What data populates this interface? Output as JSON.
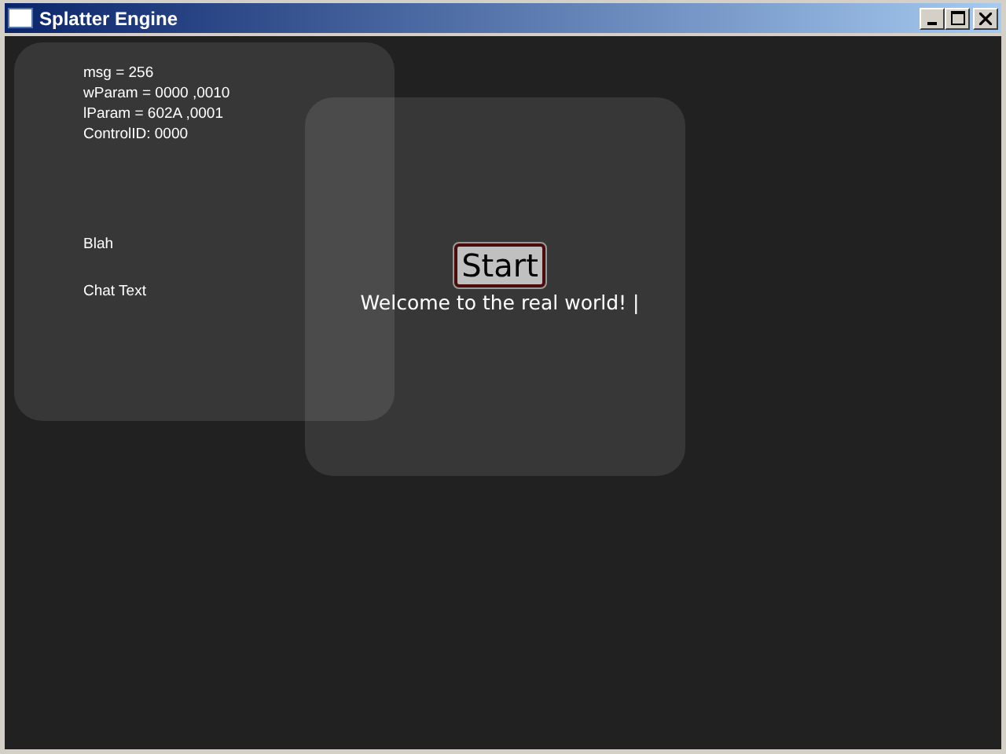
{
  "window": {
    "title": "Splatter Engine"
  },
  "debug_panel": {
    "lines": [
      "msg = 256",
      "wParam = 0000 ,0010",
      "lParam = 602A ,0001",
      "ControlID: 0000"
    ],
    "labels": [
      "Blah",
      "Chat Text"
    ]
  },
  "start_button": {
    "label": "Start"
  },
  "chat_input": {
    "value": "Welcome to the real world! |"
  }
}
